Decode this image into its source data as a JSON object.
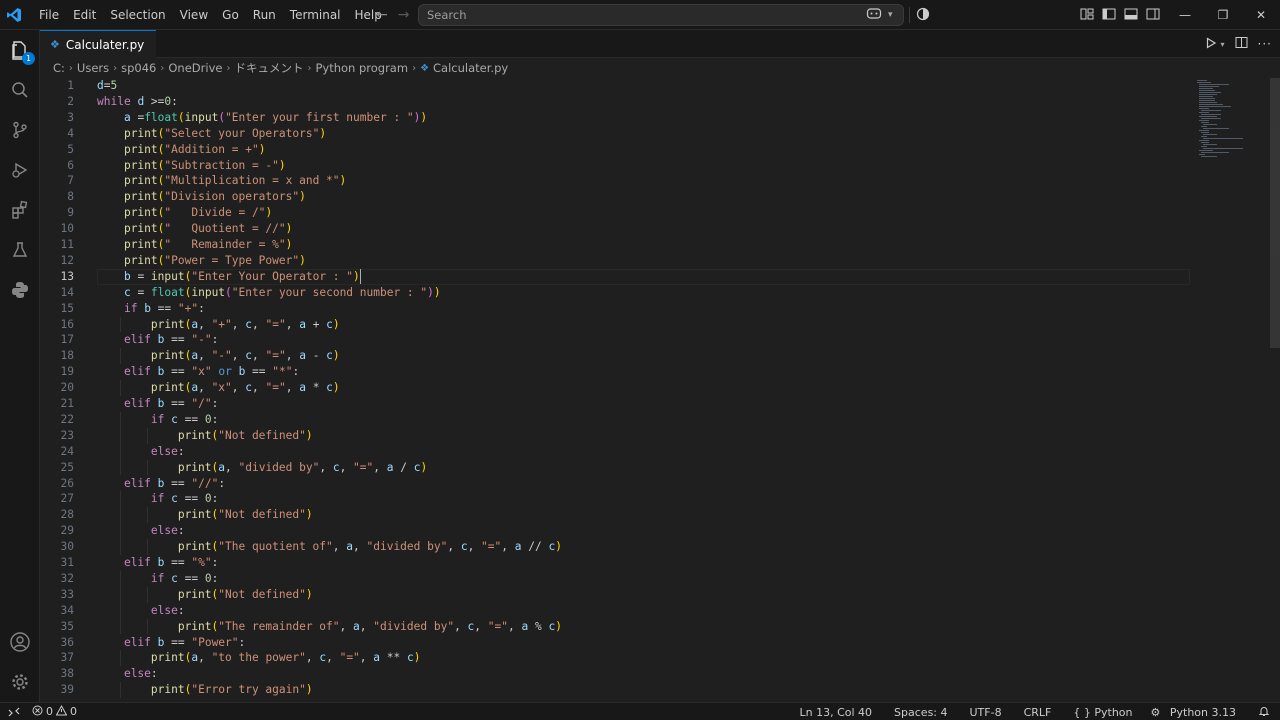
{
  "menu": [
    "File",
    "Edit",
    "Selection",
    "View",
    "Go",
    "Run",
    "Terminal",
    "Help"
  ],
  "search": {
    "placeholder": "Search"
  },
  "tab": {
    "filename": "Calculater.py"
  },
  "activity": {
    "explorer_badge": "1"
  },
  "breadcrumb": [
    "C:",
    "Users",
    "sp046",
    "OneDrive",
    "ドキュメント",
    "Python program",
    "Calculater.py"
  ],
  "editor": {
    "current_line": 13,
    "lines": [
      "d=5",
      "while d >=0:",
      "    a =float(input(\"Enter your first number : \"))",
      "    print(\"Select your Operators\")",
      "    print(\"Addition = +\")",
      "    print(\"Subtraction = -\")",
      "    print(\"Multiplication = x and *\")",
      "    print(\"Division operators\")",
      "    print(\"   Divide = /\")",
      "    print(\"   Quotient = //\")",
      "    print(\"   Remainder = %\")",
      "    print(\"Power = Type Power\")",
      "    b = input(\"Enter Your Operator : \")",
      "    c = float(input(\"Enter your second number : \"))",
      "    if b == \"+\":",
      "        print(a, \"+\", c, \"=\", a + c)",
      "    elif b == \"-\":",
      "        print(a, \"-\", c, \"=\", a - c)",
      "    elif b == \"x\" or b == \"*\":",
      "        print(a, \"x\", c, \"=\", a * c)",
      "    elif b == \"/\":",
      "        if c == 0:",
      "            print(\"Not defined\")",
      "        else:",
      "            print(a, \"divided by\", c, \"=\", a / c)",
      "    elif b == \"//\":",
      "        if c == 0:",
      "            print(\"Not defined\")",
      "        else:",
      "            print(\"The quotient of\", a, \"divided by\", c, \"=\", a // c)",
      "    elif b == \"%\":",
      "        if c == 0:",
      "            print(\"Not defined\")",
      "        else:",
      "            print(\"The remainder of\", a, \"divided by\", c, \"=\", a % c)",
      "    elif b == \"Power\":",
      "        print(a, \"to the power\", c, \"=\", a ** c)",
      "    else:",
      "        print(\"Error try again\")"
    ]
  },
  "status": {
    "errors": "0",
    "warnings": "0",
    "position": "Ln 13, Col 40",
    "spaces": "Spaces: 4",
    "encoding": "UTF-8",
    "eol": "CRLF",
    "language": "Python",
    "interpreter": "Python 3.13"
  },
  "colors": {
    "keyword": "#c586c0",
    "keyword_blue": "#569cd6",
    "function": "#dcdcaa",
    "string": "#ce9178",
    "builtin": "#4ec9b0",
    "variable": "#9cdcfe",
    "number": "#b5cea8",
    "accent": "#0078d4"
  }
}
